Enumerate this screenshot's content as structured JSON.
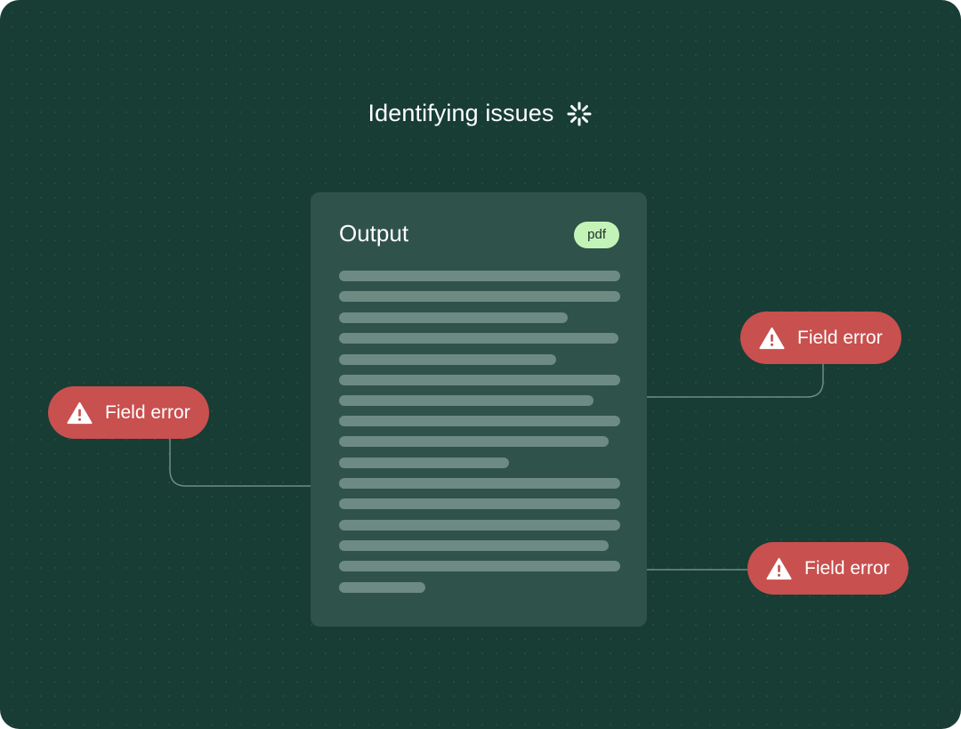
{
  "status": {
    "text": "Identifying issues",
    "icon": "loading-spinner-icon"
  },
  "document": {
    "title": "Output",
    "format_badge": "pdf",
    "content_lines": 16
  },
  "errors": [
    {
      "label": "Field error",
      "icon": "warning-icon"
    },
    {
      "label": "Field error",
      "icon": "warning-icon"
    },
    {
      "label": "Field error",
      "icon": "warning-icon"
    }
  ],
  "colors": {
    "background": "#173d35",
    "card": "#2f524b",
    "skeleton_line": "#6d8a83",
    "badge": "#c4f3b8",
    "error": "#c8504f",
    "text": "#ffffff"
  }
}
